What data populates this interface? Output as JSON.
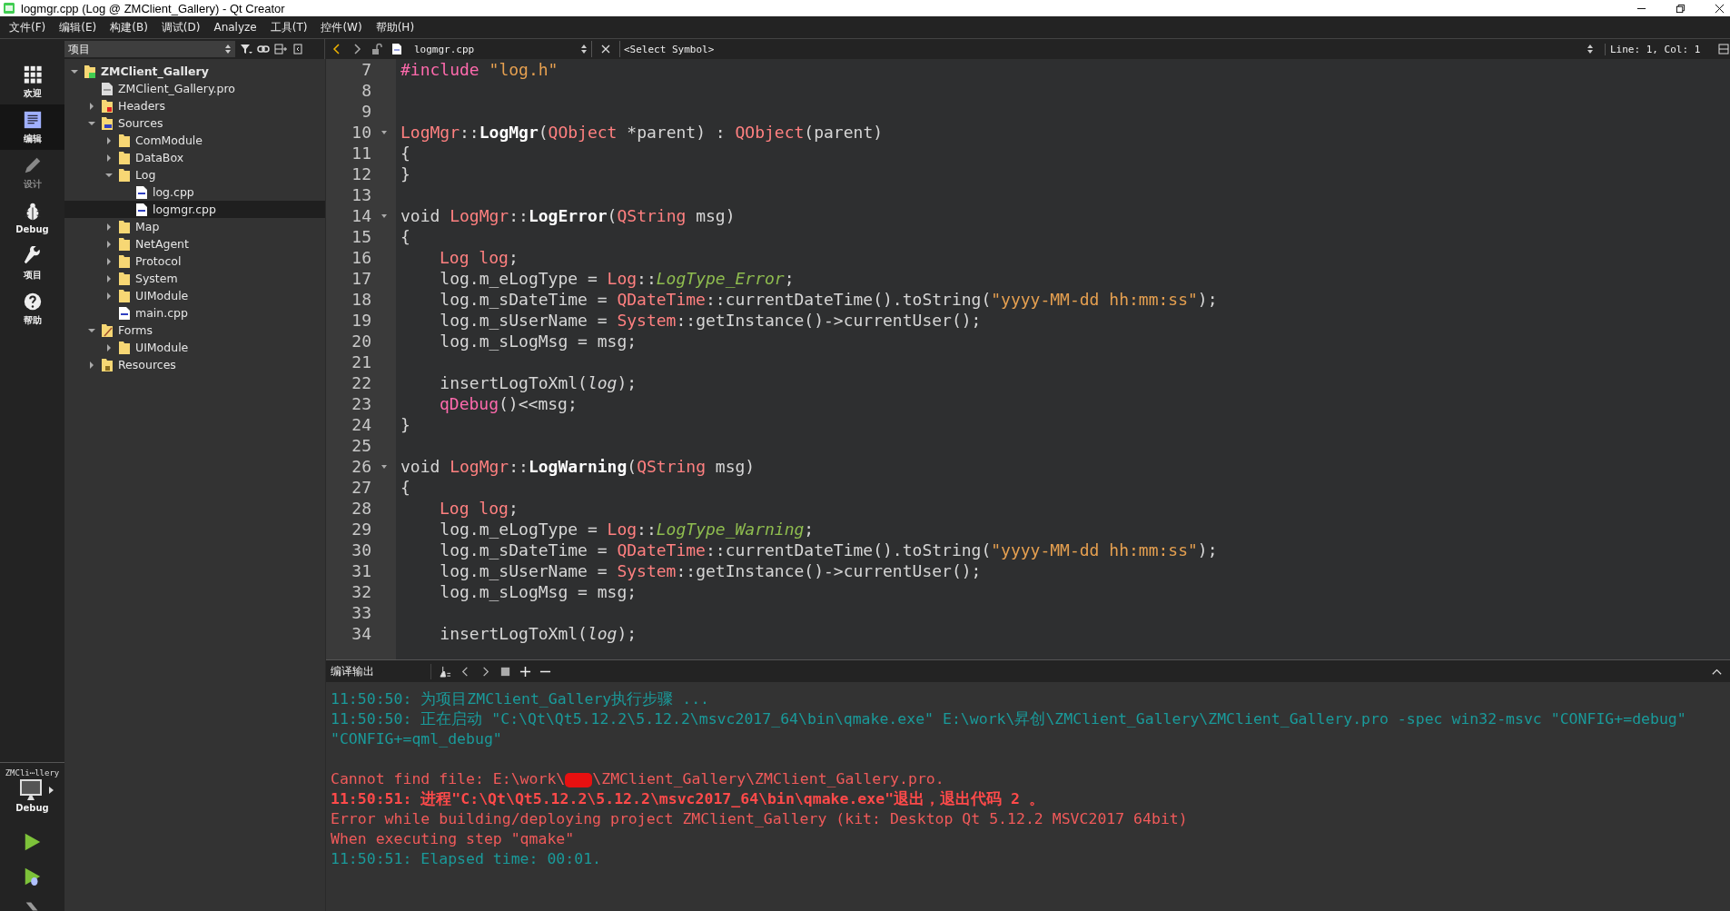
{
  "window": {
    "title": "logmgr.cpp (Log @ ZMClient_Gallery) - Qt Creator"
  },
  "menu": [
    "文件(F)",
    "编辑(E)",
    "构建(B)",
    "调试(D)",
    "Analyze",
    "工具(T)",
    "控件(W)",
    "帮助(H)"
  ],
  "modes": [
    {
      "label": "欢迎",
      "kind": "welcome",
      "selected": false,
      "disabled": false
    },
    {
      "label": "编辑",
      "kind": "edit",
      "selected": true,
      "disabled": false
    },
    {
      "label": "设计",
      "kind": "design",
      "selected": false,
      "disabled": true
    },
    {
      "label": "Debug",
      "kind": "debug",
      "selected": false,
      "disabled": false
    },
    {
      "label": "项目",
      "kind": "projects",
      "selected": false,
      "disabled": false
    },
    {
      "label": "帮助",
      "kind": "help",
      "selected": false,
      "disabled": false
    }
  ],
  "kit": {
    "project": "ZMCli⋯llery",
    "config": "Debug"
  },
  "project_panel": {
    "view": "项目"
  },
  "tree": [
    {
      "label": "ZMClient_Gallery",
      "kind": "project",
      "expanded": true,
      "selected": false,
      "children": [
        {
          "label": "ZMClient_Gallery.pro",
          "kind": "pro",
          "selected": false
        },
        {
          "label": "Headers",
          "kind": "headers",
          "expanded": false,
          "selected": false
        },
        {
          "label": "Sources",
          "kind": "sources",
          "expanded": true,
          "selected": false,
          "children": [
            {
              "label": "ComModule",
              "kind": "folder",
              "expanded": false,
              "selected": false
            },
            {
              "label": "DataBox",
              "kind": "folder",
              "expanded": false,
              "selected": false
            },
            {
              "label": "Log",
              "kind": "folder",
              "expanded": true,
              "selected": false,
              "children": [
                {
                  "label": "log.cpp",
                  "kind": "cpp",
                  "selected": false
                },
                {
                  "label": "logmgr.cpp",
                  "kind": "cpp",
                  "selected": true
                }
              ]
            },
            {
              "label": "Map",
              "kind": "folder",
              "expanded": false,
              "selected": false
            },
            {
              "label": "NetAgent",
              "kind": "folder",
              "expanded": false,
              "selected": false
            },
            {
              "label": "Protocol",
              "kind": "folder",
              "expanded": false,
              "selected": false
            },
            {
              "label": "System",
              "kind": "folder",
              "expanded": false,
              "selected": false
            },
            {
              "label": "UIModule",
              "kind": "folder",
              "expanded": false,
              "selected": false
            },
            {
              "label": "main.cpp",
              "kind": "cpp",
              "selected": false
            }
          ]
        },
        {
          "label": "Forms",
          "kind": "forms",
          "expanded": true,
          "selected": false,
          "children": [
            {
              "label": "UIModule",
              "kind": "folder",
              "expanded": false,
              "selected": false
            }
          ]
        },
        {
          "label": "Resources",
          "kind": "resources",
          "expanded": false,
          "selected": false
        }
      ]
    }
  ],
  "editor": {
    "file": "logmgr.cpp",
    "symbol": "<Select Symbol>",
    "position": "Line: 1, Col: 1",
    "lines": [
      {
        "number": "7",
        "tokens": [
          {
            "kind": "pre",
            "text": "#include "
          },
          {
            "kind": "string",
            "text": "\"log.h\""
          }
        ]
      },
      {
        "number": "8"
      },
      {
        "number": "9"
      },
      {
        "number": "10",
        "fold": true,
        "tokens": [
          {
            "kind": "type",
            "text": "LogMgr"
          },
          {
            "kind": "plain",
            "text": "::"
          },
          {
            "kind": "decl",
            "text": "LogMgr"
          },
          {
            "kind": "plain",
            "text": "("
          },
          {
            "kind": "type",
            "text": "QObject"
          },
          {
            "kind": "plain",
            "text": " *parent) : "
          },
          {
            "kind": "type",
            "text": "QObject"
          },
          {
            "kind": "plain",
            "text": "(parent)"
          }
        ]
      },
      {
        "number": "11",
        "tokens": [
          {
            "kind": "plain",
            "text": "{"
          }
        ]
      },
      {
        "number": "12",
        "tokens": [
          {
            "kind": "plain",
            "text": "}"
          }
        ]
      },
      {
        "number": "13"
      },
      {
        "number": "14",
        "fold": true,
        "tokens": [
          {
            "kind": "plain",
            "text": "void "
          },
          {
            "kind": "type",
            "text": "LogMgr"
          },
          {
            "kind": "plain",
            "text": "::"
          },
          {
            "kind": "decl",
            "text": "LogError"
          },
          {
            "kind": "plain",
            "text": "("
          },
          {
            "kind": "type",
            "text": "QString"
          },
          {
            "kind": "plain",
            "text": " msg)"
          }
        ]
      },
      {
        "number": "15",
        "tokens": [
          {
            "kind": "plain",
            "text": "{"
          }
        ]
      },
      {
        "number": "16",
        "indented": true,
        "tokens": [
          {
            "kind": "type",
            "text": "Log "
          },
          {
            "kind": "local",
            "text": "log"
          },
          {
            "kind": "plain",
            "text": ";"
          }
        ]
      },
      {
        "number": "17",
        "tokens": [
          {
            "kind": "plain",
            "text": "    log.m_eLogType = "
          },
          {
            "kind": "type",
            "text": "Log"
          },
          {
            "kind": "plain",
            "text": "::"
          },
          {
            "kind": "enum",
            "text": "LogType_Error"
          },
          {
            "kind": "plain",
            "text": ";"
          }
        ]
      },
      {
        "number": "18",
        "tokens": [
          {
            "kind": "plain",
            "text": "    log.m_sDateTime = "
          },
          {
            "kind": "type",
            "text": "QDateTime"
          },
          {
            "kind": "plain",
            "text": "::currentDateTime().toString("
          },
          {
            "kind": "string",
            "text": "\"yyyy-MM-dd hh:mm:ss\""
          },
          {
            "kind": "plain",
            "text": ");"
          }
        ]
      },
      {
        "number": "19",
        "tokens": [
          {
            "kind": "plain",
            "text": "    log.m_sUserName = "
          },
          {
            "kind": "type",
            "text": "System"
          },
          {
            "kind": "plain",
            "text": "::getInstance()->currentUser();"
          }
        ]
      },
      {
        "number": "20",
        "tokens": [
          {
            "kind": "plain",
            "text": "    log.m_sLogMsg = msg;"
          }
        ]
      },
      {
        "number": "21"
      },
      {
        "number": "22",
        "tokens": [
          {
            "kind": "plain",
            "text": "    insertLogToXml("
          },
          {
            "kind": "italic",
            "text": "log"
          },
          {
            "kind": "plain",
            "text": ");"
          }
        ]
      },
      {
        "number": "23",
        "indented": true,
        "tokens": [
          {
            "kind": "macro",
            "text": "qDebug"
          },
          {
            "kind": "plain",
            "text": "()<<msg;"
          }
        ]
      },
      {
        "number": "24",
        "tokens": [
          {
            "kind": "plain",
            "text": "}"
          }
        ]
      },
      {
        "number": "25"
      },
      {
        "number": "26",
        "fold": true,
        "tokens": [
          {
            "kind": "plain",
            "text": "void "
          },
          {
            "kind": "type",
            "text": "LogMgr"
          },
          {
            "kind": "plain",
            "text": "::"
          },
          {
            "kind": "decl",
            "text": "LogWarning"
          },
          {
            "kind": "plain",
            "text": "("
          },
          {
            "kind": "type",
            "text": "QString"
          },
          {
            "kind": "plain",
            "text": " msg)"
          }
        ]
      },
      {
        "number": "27",
        "tokens": [
          {
            "kind": "plain",
            "text": "{"
          }
        ]
      },
      {
        "number": "28",
        "indented": true,
        "tokens": [
          {
            "kind": "type",
            "text": "Log "
          },
          {
            "kind": "local",
            "text": "log"
          },
          {
            "kind": "plain",
            "text": ";"
          }
        ]
      },
      {
        "number": "29",
        "tokens": [
          {
            "kind": "plain",
            "text": "    log.m_eLogType = "
          },
          {
            "kind": "type",
            "text": "Log"
          },
          {
            "kind": "plain",
            "text": "::"
          },
          {
            "kind": "enum",
            "text": "LogType_Warning"
          },
          {
            "kind": "plain",
            "text": ";"
          }
        ]
      },
      {
        "number": "30",
        "tokens": [
          {
            "kind": "plain",
            "text": "    log.m_sDateTime = "
          },
          {
            "kind": "type",
            "text": "QDateTime"
          },
          {
            "kind": "plain",
            "text": "::currentDateTime().toString("
          },
          {
            "kind": "string",
            "text": "\"yyyy-MM-dd hh:mm:ss\""
          },
          {
            "kind": "plain",
            "text": ");"
          }
        ]
      },
      {
        "number": "31",
        "tokens": [
          {
            "kind": "plain",
            "text": "    log.m_sUserName = "
          },
          {
            "kind": "type",
            "text": "System"
          },
          {
            "kind": "plain",
            "text": "::getInstance()->currentUser();"
          }
        ]
      },
      {
        "number": "32",
        "tokens": [
          {
            "kind": "plain",
            "text": "    log.m_sLogMsg = msg;"
          }
        ]
      },
      {
        "number": "33"
      },
      {
        "number": "34",
        "tokens": [
          {
            "kind": "plain",
            "text": "    insertLogToXml("
          },
          {
            "kind": "italic",
            "text": "log"
          },
          {
            "kind": "plain",
            "text": ");"
          }
        ]
      }
    ]
  },
  "output": {
    "title": "编译输出",
    "lines": [
      {
        "kind": "info",
        "parts": [
          {
            "text": "11:50:50: 为项目ZMClient_Gallery执行步骤 ..."
          }
        ]
      },
      {
        "kind": "info",
        "parts": [
          {
            "text": "11:50:50: 正在启动 \"C:\\Qt\\Qt5.12.2\\5.12.2\\msvc2017_64\\bin\\qmake.exe\" E:\\work\\昇创\\ZMClient_Gallery\\ZMClient_Gallery.pro -spec win32-msvc \"CONFIG+=debug\" \"CONFIG+=qml_debug\""
          }
        ]
      },
      {
        "kind": "error",
        "blank_before": true,
        "parts": [
          {
            "text": "Cannot find file: E:\\work\\"
          },
          {
            "redacted": true
          },
          {
            "text": "\\ZMClient_Gallery\\ZMClient_Gallery.pro."
          }
        ]
      },
      {
        "kind": "error_bold",
        "parts": [
          {
            "text": "11:50:51: 进程\"C:\\Qt\\Qt5.12.2\\5.12.2\\msvc2017_64\\bin\\qmake.exe\"退出，退出代码 2 。"
          }
        ]
      },
      {
        "kind": "error",
        "parts": [
          {
            "text": "Error while building/deploying project ZMClient_Gallery (kit: Desktop Qt 5.12.2 MSVC2017 64bit)"
          }
        ]
      },
      {
        "kind": "error",
        "parts": [
          {
            "text": "When executing step \"qmake\""
          }
        ]
      },
      {
        "kind": "info",
        "parts": [
          {
            "text": "11:50:51: Elapsed time: 00:01."
          }
        ]
      }
    ]
  }
}
